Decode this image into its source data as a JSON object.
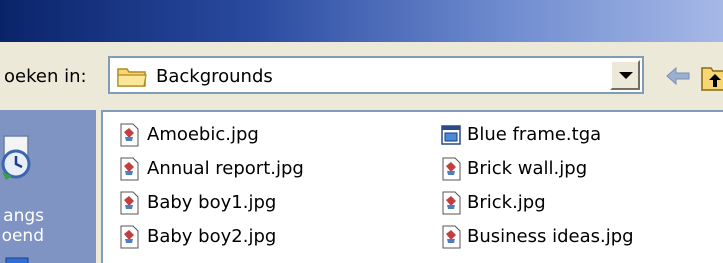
{
  "window": {
    "title_left": "",
    "title_right": ""
  },
  "toolbar": {
    "look_in_label": "oeken in:",
    "current_folder": "Backgrounds"
  },
  "places": {
    "label_line1": "angs",
    "label_line2": "oend"
  },
  "files": [
    {
      "name": "Amoebic.jpg",
      "icon": "jpg-image-icon"
    },
    {
      "name": "Annual report.jpg",
      "icon": "jpg-image-icon"
    },
    {
      "name": "Baby boy1.jpg",
      "icon": "jpg-image-icon"
    },
    {
      "name": "Baby boy2.jpg",
      "icon": "jpg-image-icon"
    },
    {
      "name": "Blue frame.tga",
      "icon": "tga-image-icon"
    },
    {
      "name": "Brick wall.jpg",
      "icon": "jpg-image-icon"
    },
    {
      "name": "Brick.jpg",
      "icon": "jpg-image-icon"
    },
    {
      "name": "Business ideas.jpg",
      "icon": "jpg-image-icon"
    }
  ],
  "colors": {
    "title_bar_start": "#0a246a",
    "title_bar_end": "#a6b8e6",
    "dialog_background": "#ece9d8",
    "places_bar": "#8094c4",
    "list_background": "#ffffff"
  }
}
